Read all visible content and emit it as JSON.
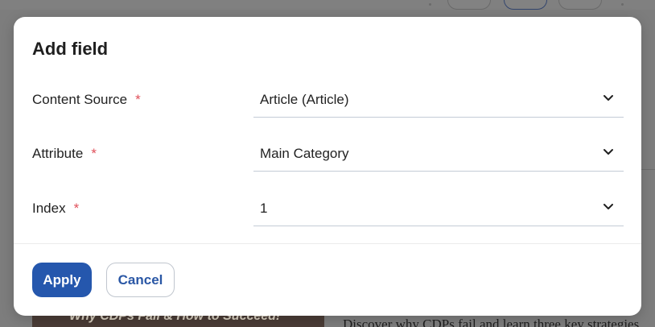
{
  "background": {
    "thumbnail_caption": "Why CDPs Fail & How to Succeed!",
    "snippet_text": "Discover why CDPs fail and learn three key strategies"
  },
  "dialog": {
    "title": "Add field",
    "required_marker": "*",
    "fields": [
      {
        "label": "Content Source",
        "value": "Article (Article)",
        "icon": "chevron-down-icon"
      },
      {
        "label": "Attribute",
        "value": "Main Category",
        "icon": "chevron-down-icon"
      },
      {
        "label": "Index",
        "value": "1",
        "icon": "chevron-down-icon"
      }
    ],
    "apply_label": "Apply",
    "cancel_label": "Cancel"
  },
  "colors": {
    "primary": "#2557ad",
    "required": "#e0505a",
    "overlay": "#7d7d7d"
  }
}
